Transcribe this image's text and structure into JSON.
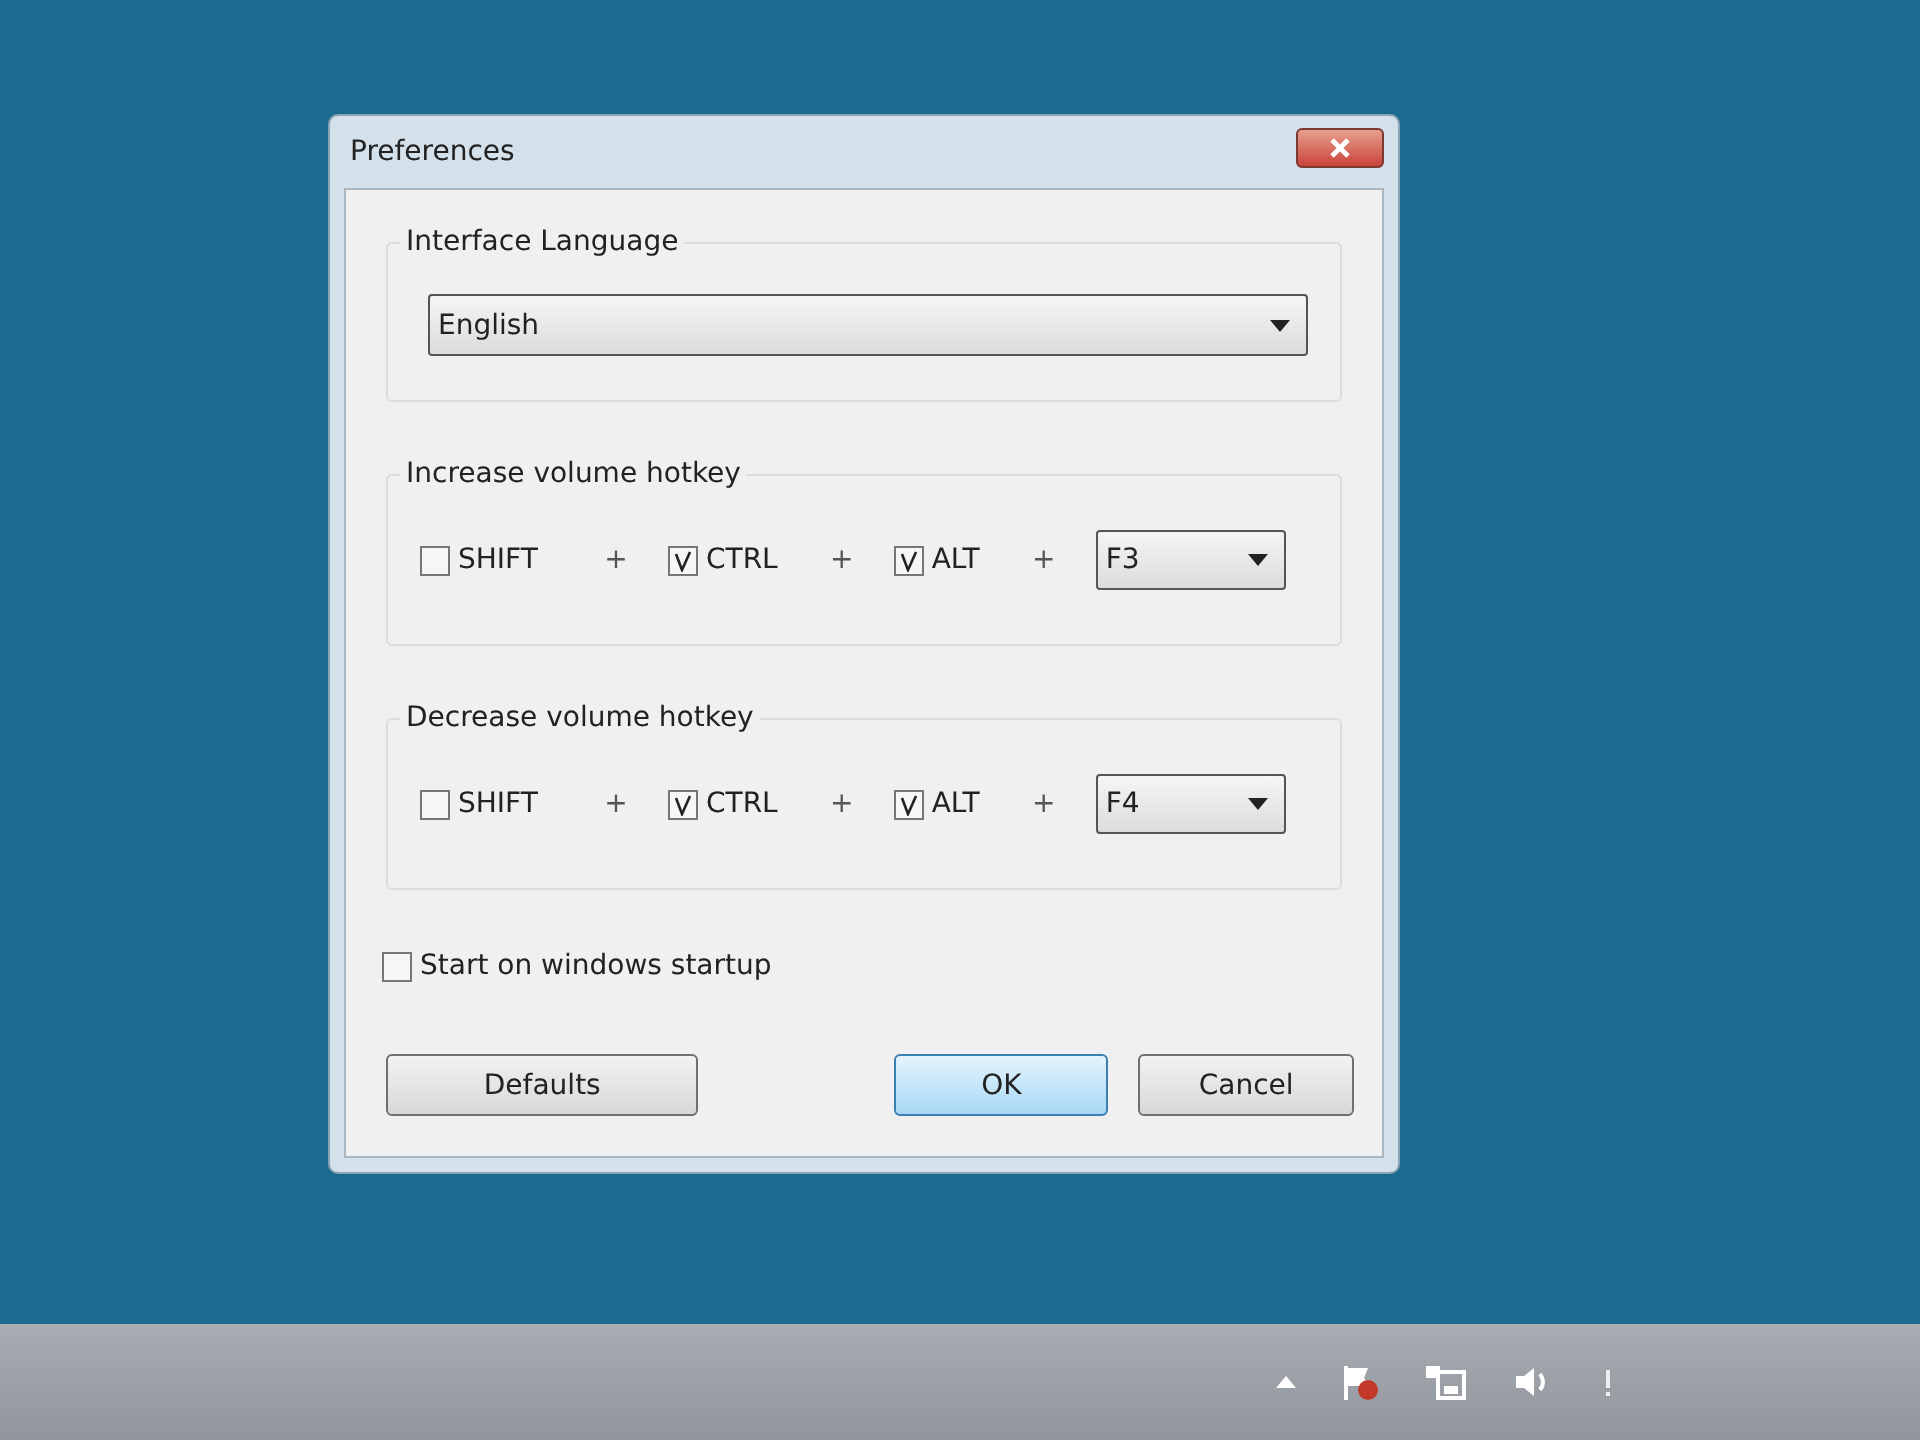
{
  "dialog": {
    "title": "Preferences",
    "language": {
      "label": "Interface Language",
      "value": "English"
    },
    "hotkeys": [
      {
        "label": "Increase volume hotkey",
        "modifiers": [
          {
            "label": "SHIFT",
            "checked": false,
            "then": "+"
          },
          {
            "label": "CTRL",
            "checked": true,
            "then": "+"
          },
          {
            "label": "ALT",
            "checked": true,
            "then": "+"
          }
        ],
        "key": "F3"
      },
      {
        "label": "Decrease volume hotkey",
        "modifiers": [
          {
            "label": "SHIFT",
            "checked": false,
            "then": "+"
          },
          {
            "label": "CTRL",
            "checked": true,
            "then": "+"
          },
          {
            "label": "ALT",
            "checked": true,
            "then": "+"
          }
        ],
        "key": "F4"
      }
    ],
    "startup": {
      "label": "Start on windows startup",
      "checked": false
    },
    "buttons": [
      {
        "label": "Defaults",
        "focused": false
      },
      {
        "label": "OK",
        "focused": true
      },
      {
        "label": "Cancel",
        "focused": false
      }
    ]
  }
}
